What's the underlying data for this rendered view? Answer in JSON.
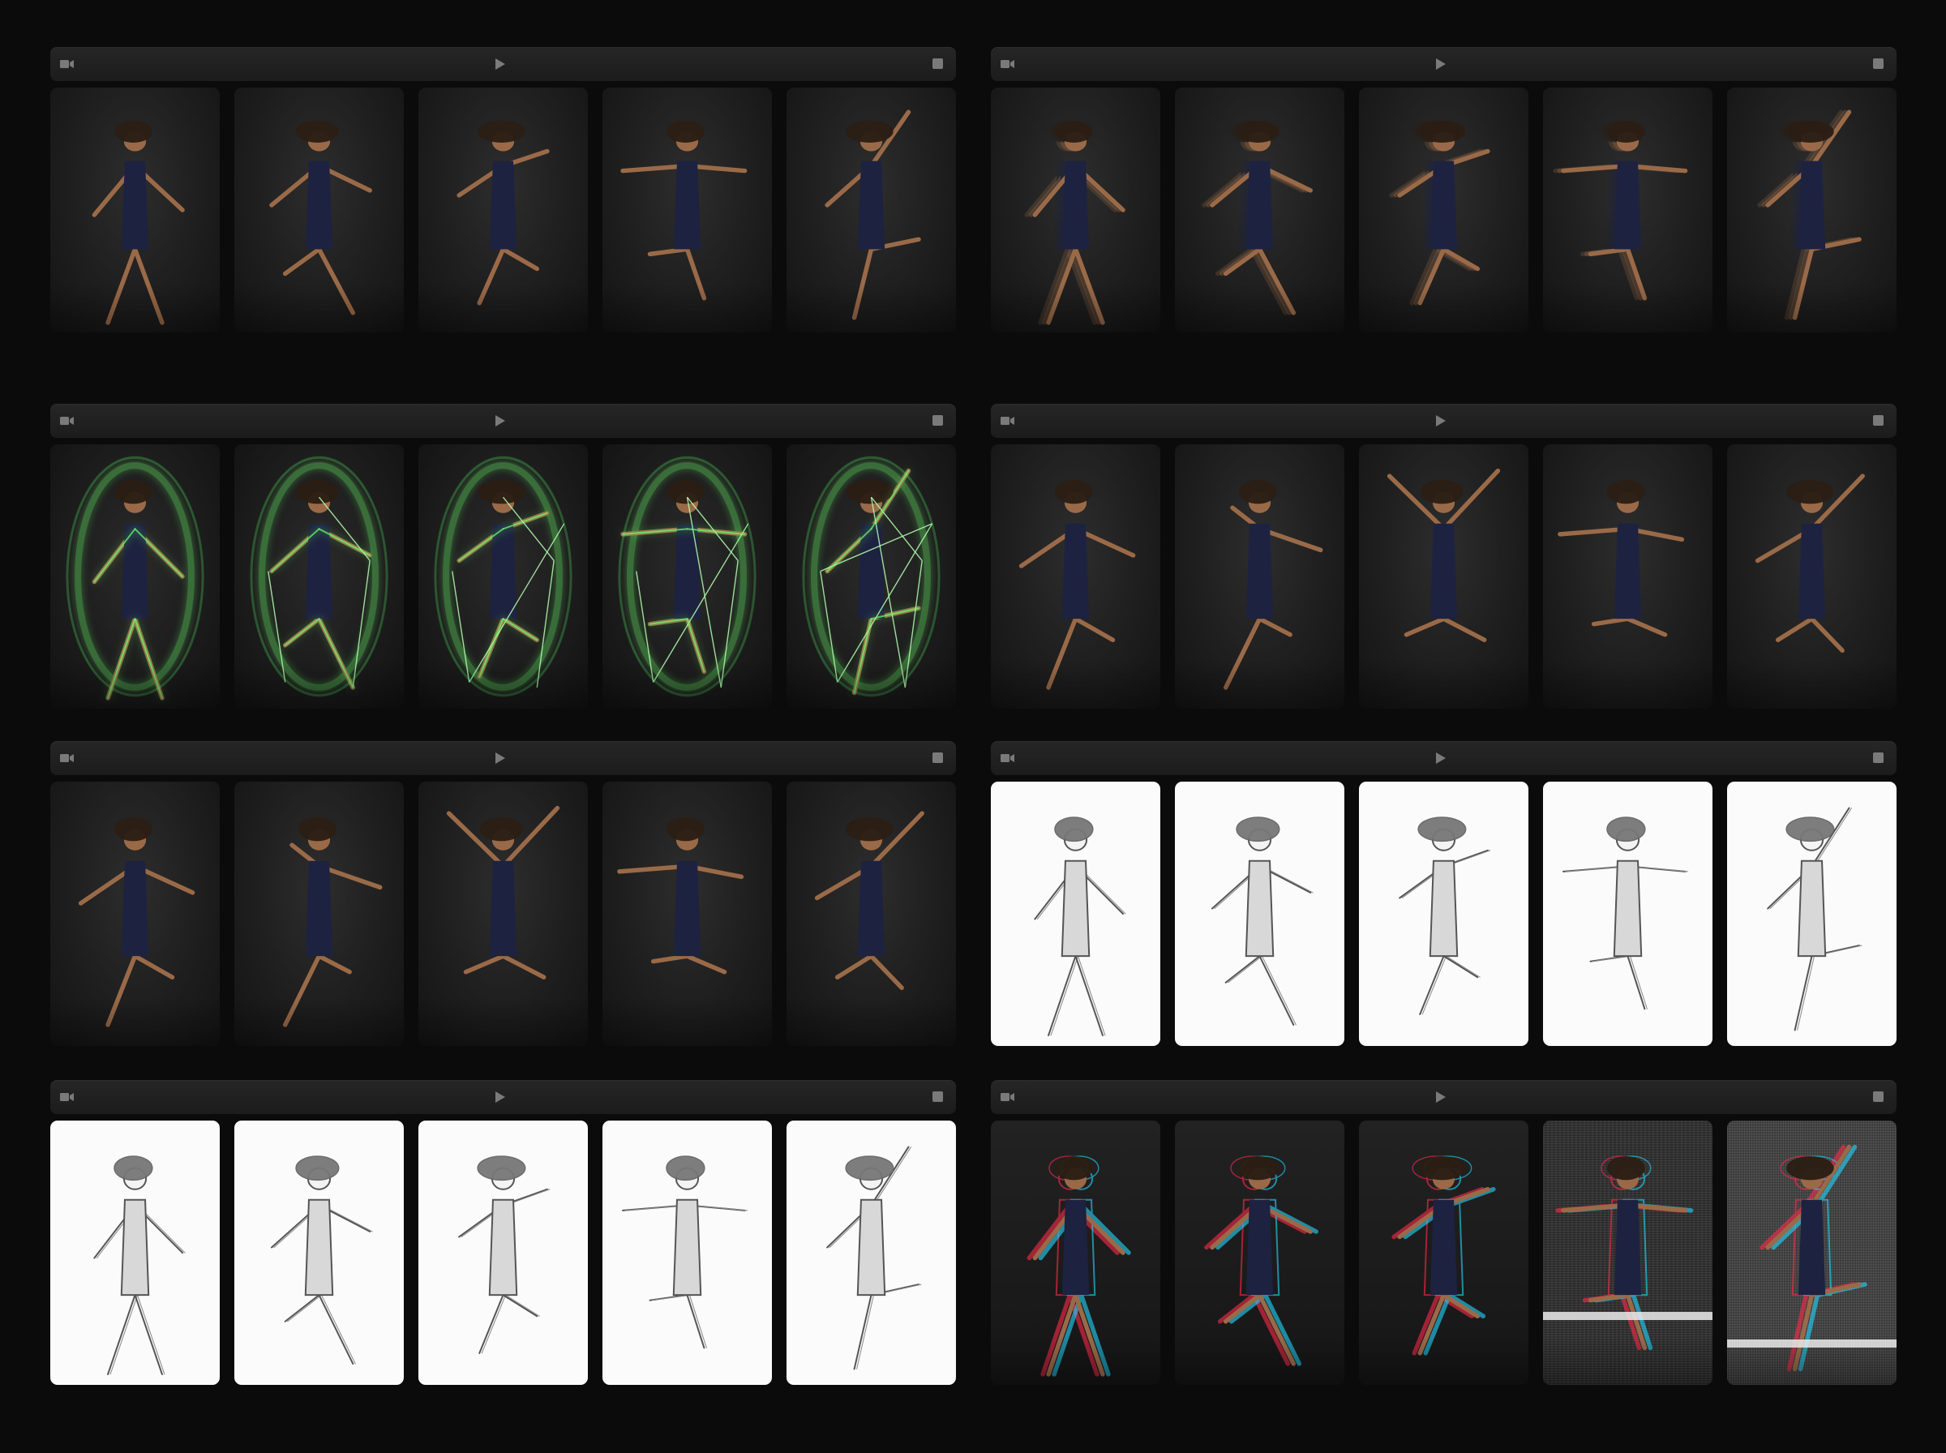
{
  "controls": {
    "camera_icon": "camera-icon",
    "play_icon": "play-icon",
    "stop_icon": "stop-icon"
  },
  "colors": {
    "page_background": "#0b0b0b",
    "toolbar": "#232323",
    "icon": "#7a7a7a",
    "green_glow": "#6dff6d",
    "sketch_paper": "#fbfbfb"
  },
  "panels": [
    {
      "style": "photo",
      "frame_count": 5
    },
    {
      "style": "motion-blur",
      "frame_count": 5
    },
    {
      "style": "green-glow-wireframe",
      "frame_count": 5
    },
    {
      "style": "photo",
      "frame_count": 5
    },
    {
      "style": "photo",
      "frame_count": 5
    },
    {
      "style": "pencil-sketch",
      "frame_count": 5
    },
    {
      "style": "pencil-sketch",
      "frame_count": 5
    },
    {
      "style": "rgb-glitch",
      "frame_count": 5
    }
  ]
}
